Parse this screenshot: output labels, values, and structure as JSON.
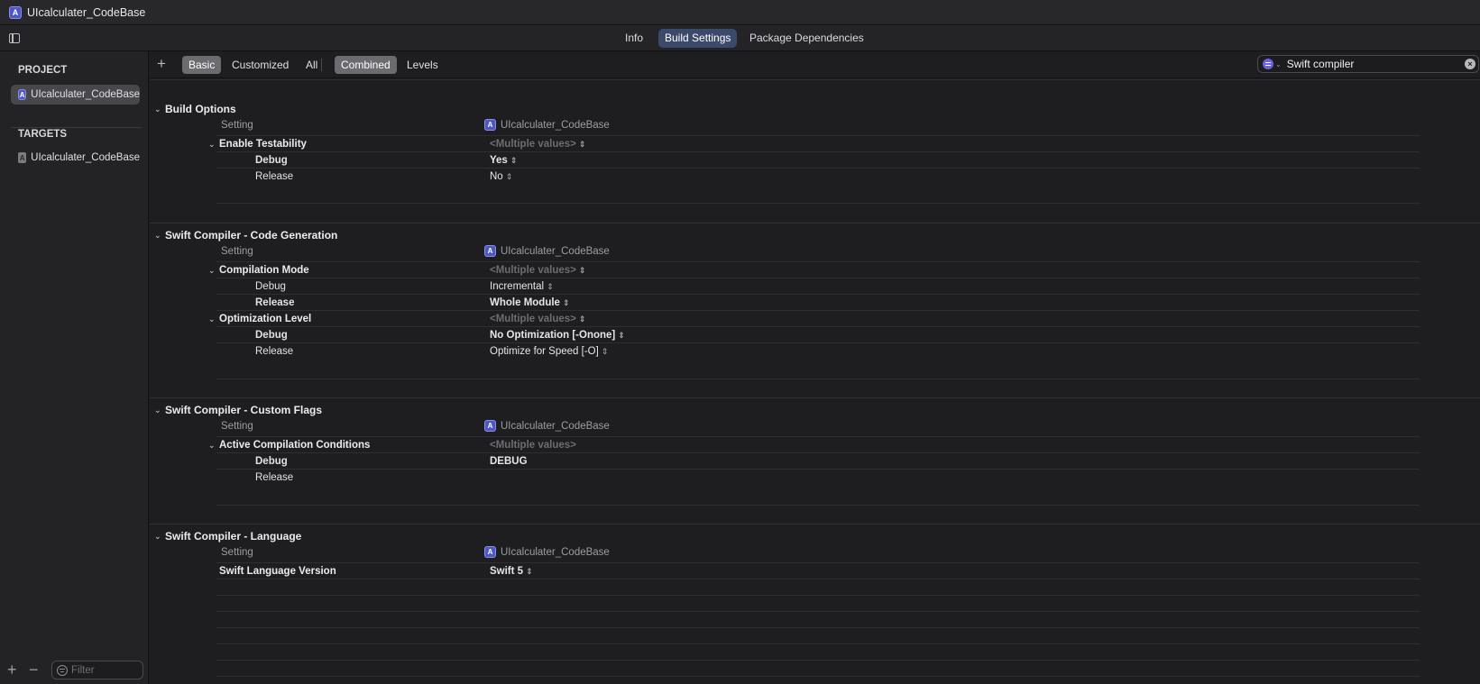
{
  "window": {
    "title": "UIcalculater_CodeBase",
    "app_icon_glyph": "A"
  },
  "tabs": [
    {
      "label": "Info"
    },
    {
      "label": "Build Settings"
    },
    {
      "label": "Package Dependencies"
    }
  ],
  "navigator": {
    "project_header": "PROJECT",
    "project_item": "UIcalculater_CodeBase",
    "targets_header": "TARGETS",
    "target_item": "UIcalculater_CodeBase",
    "filter_placeholder": "Filter"
  },
  "toolbar": {
    "scope_basic": "Basic",
    "scope_customized": "Customized",
    "scope_all": "All",
    "view_combined": "Combined",
    "view_levels": "Levels",
    "search_value": "Swift compiler"
  },
  "sections": {
    "build_options": {
      "title": "Build Options",
      "col_setting": "Setting",
      "col_target": "UIcalculater_CodeBase",
      "enable_testability": {
        "name": "Enable Testability",
        "value": "<Multiple values>",
        "debug_label": "Debug",
        "debug_value": "Yes",
        "release_label": "Release",
        "release_value": "No"
      }
    },
    "code_generation": {
      "title": "Swift Compiler - Code Generation",
      "col_setting": "Setting",
      "col_target": "UIcalculater_CodeBase",
      "compilation_mode": {
        "name": "Compilation Mode",
        "value": "<Multiple values>",
        "debug_label": "Debug",
        "debug_value": "Incremental",
        "release_label": "Release",
        "release_value": "Whole Module"
      },
      "optimization_level": {
        "name": "Optimization Level",
        "value": "<Multiple values>",
        "debug_label": "Debug",
        "debug_value": "No Optimization [-Onone]",
        "release_label": "Release",
        "release_value": "Optimize for Speed [-O]"
      }
    },
    "custom_flags": {
      "title": "Swift Compiler - Custom Flags",
      "col_setting": "Setting",
      "col_target": "UIcalculater_CodeBase",
      "active_conditions": {
        "name": "Active Compilation Conditions",
        "value": "<Multiple values>",
        "debug_label": "Debug",
        "debug_value": "DEBUG",
        "release_label": "Release"
      }
    },
    "language": {
      "title": "Swift Compiler - Language",
      "col_setting": "Setting",
      "col_target": "UIcalculater_CodeBase",
      "swift_version": {
        "name": "Swift Language Version",
        "value": "Swift 5"
      }
    }
  },
  "colors": {
    "accent_tab": "#3b4a6b",
    "app_icon": "#4e57c8",
    "segment_on": "#6b6b70"
  },
  "icons": [
    "app-icon",
    "sidebar-toggle-icon",
    "chevron-down-icon",
    "stepper-icon",
    "filter-icon",
    "search-scope-icon",
    "clear-icon",
    "plus-icon",
    "minus-icon"
  ]
}
